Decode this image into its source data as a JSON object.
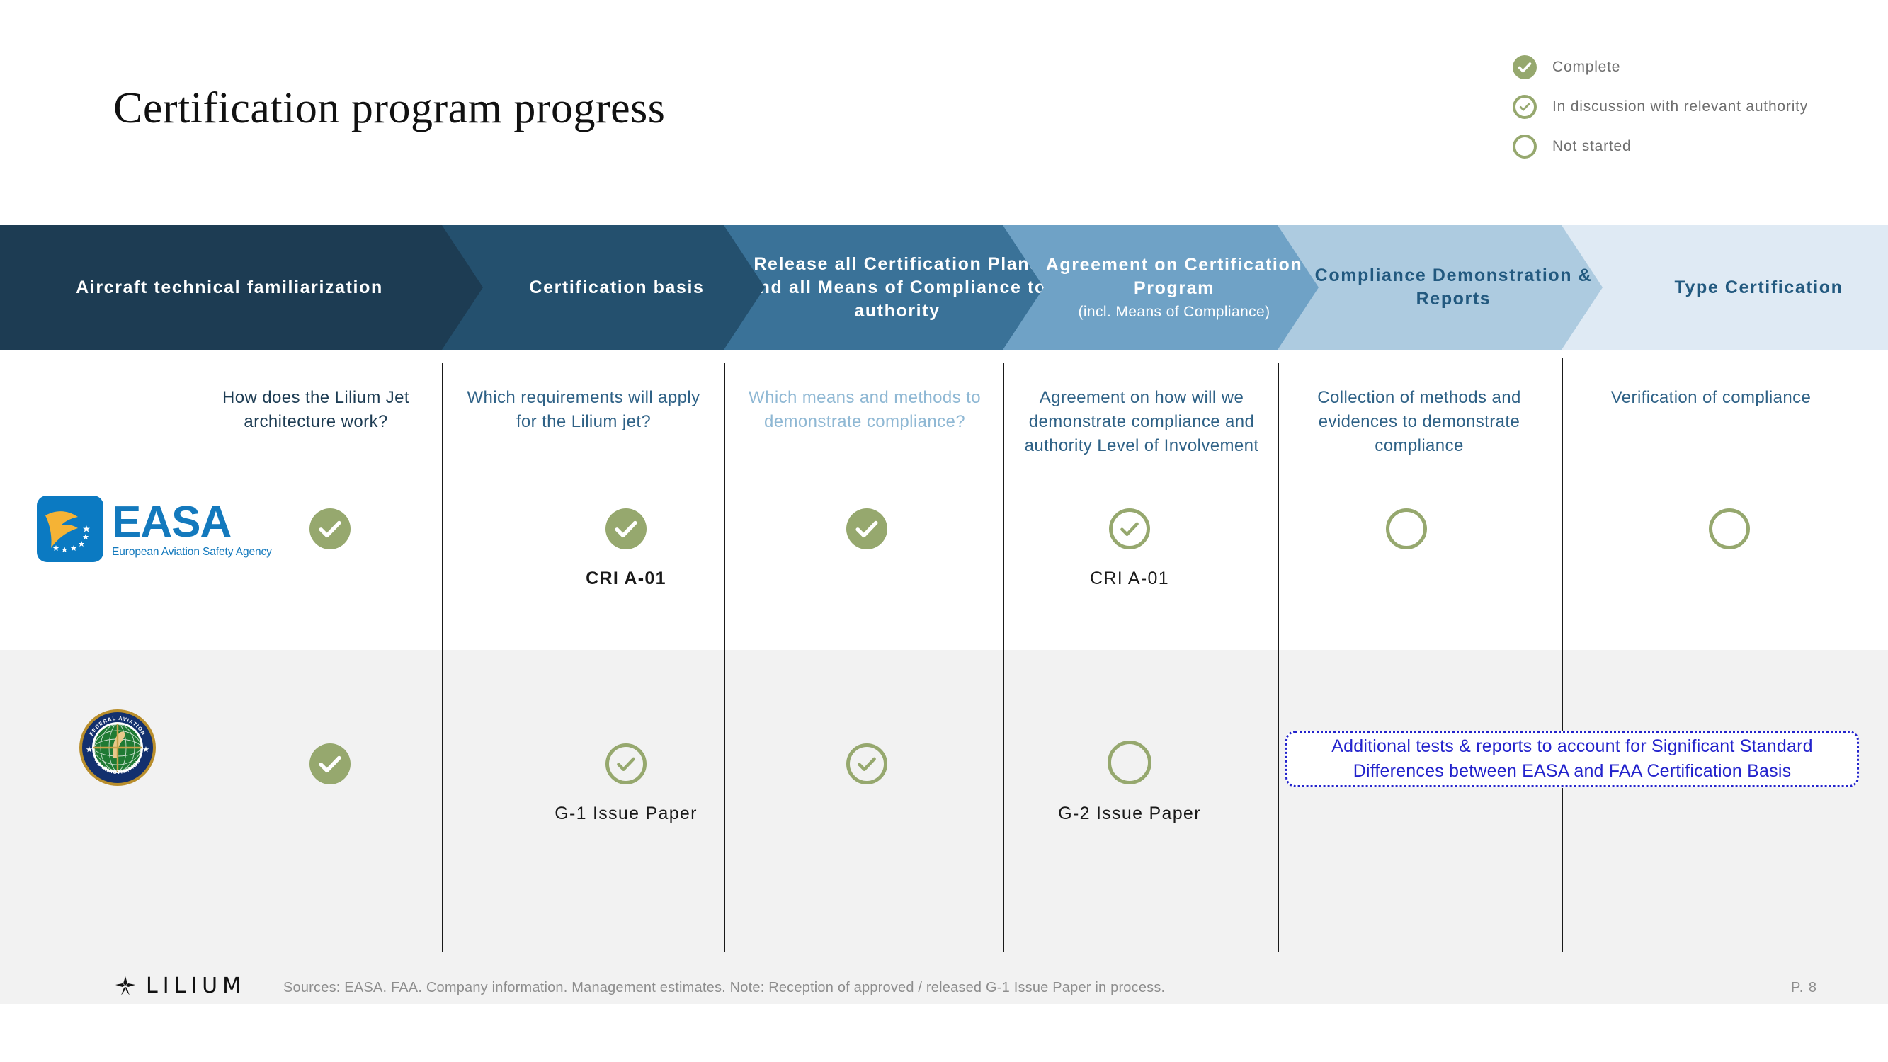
{
  "title": "Certification program progress",
  "legend": {
    "items": [
      {
        "label": "Complete",
        "state": "complete"
      },
      {
        "label": "In discussion with relevant authority",
        "state": "in-discussion"
      },
      {
        "label": "Not started",
        "state": "not-started"
      }
    ]
  },
  "colors": {
    "marker_green": "#96a86e",
    "callout_blue": "#2323cc",
    "stage_1": "#1d3c53",
    "stage_2": "#24506e",
    "stage_3": "#3a7298",
    "stage_4": "#6fa2c6",
    "stage_5": "#adcbe0",
    "stage_6": "#dfeaf4"
  },
  "stages": [
    {
      "label": "Aircraft technical familiarization",
      "sub": "",
      "bg": "#1d3c53",
      "fg": "#ffffff",
      "description": "How does the Lilium Jet architecture work?",
      "description_color": "#1d3c53"
    },
    {
      "label": "Certification basis",
      "sub": "",
      "bg": "#24506e",
      "fg": "#ffffff",
      "description": "Which requirements will apply for the Lilium jet?",
      "description_color": "#2e6186"
    },
    {
      "label": "Release all Certification Plans and all Means of Compliance to authority",
      "sub": "",
      "bg": "#3a7298",
      "fg": "#ffffff",
      "description": "Which means and methods to demonstrate compliance?",
      "description_color": "#8fb8d4"
    },
    {
      "label": "Agreement on Certification Program",
      "sub": "(incl. Means of Compliance)",
      "bg": "#6fa2c6",
      "fg": "#ffffff",
      "description": "Agreement on how will we demonstrate compliance and authority Level of Involvement",
      "description_color": "#2e6186"
    },
    {
      "label": "Compliance Demonstration & Reports",
      "sub": "",
      "bg": "#adcbe0",
      "fg": "#22597f",
      "description": "Collection of methods and evidences to demonstrate compliance",
      "description_color": "#2e6186"
    },
    {
      "label": "Type Certification",
      "sub": "",
      "bg": "#dfeaf4",
      "fg": "#22597f",
      "description": "Verification of compliance",
      "description_color": "#2e6186"
    }
  ],
  "authorities": [
    {
      "name": "EASA",
      "logo_name": "easa-logo",
      "logo_text": "EASA",
      "logo_tagline": "European Aviation Safety Agency",
      "cells": [
        {
          "state": "complete",
          "label": ""
        },
        {
          "state": "complete",
          "label": "CRI A-01",
          "label_bold": true
        },
        {
          "state": "complete",
          "label": ""
        },
        {
          "state": "in-discussion",
          "label": "CRI A-01",
          "label_bold": false
        },
        {
          "state": "not-started",
          "label": ""
        },
        {
          "state": "not-started",
          "label": ""
        }
      ]
    },
    {
      "name": "FAA",
      "logo_name": "faa-seal",
      "logo_text_top": "FEDERAL AVIATION",
      "logo_text_bottom": "ADMINISTRATION",
      "cells": [
        {
          "state": "complete",
          "label": ""
        },
        {
          "state": "in-discussion",
          "label": "G-1 Issue Paper",
          "label_bold": false
        },
        {
          "state": "in-discussion",
          "label": ""
        },
        {
          "state": "not-started",
          "label": "G-2 Issue Paper",
          "label_bold": false
        },
        {
          "state": "none",
          "label": ""
        },
        {
          "state": "none",
          "label": ""
        }
      ]
    }
  ],
  "callout": {
    "text": "Additional tests & reports to account for Significant Standard Differences between EASA and FAA Certification Basis"
  },
  "footer": {
    "brand": "LILIUM",
    "sources": "Sources: EASA. FAA. Company information. Management estimates. Note: Reception of approved / released G-1 Issue Paper in process.",
    "page": "P. 8"
  }
}
